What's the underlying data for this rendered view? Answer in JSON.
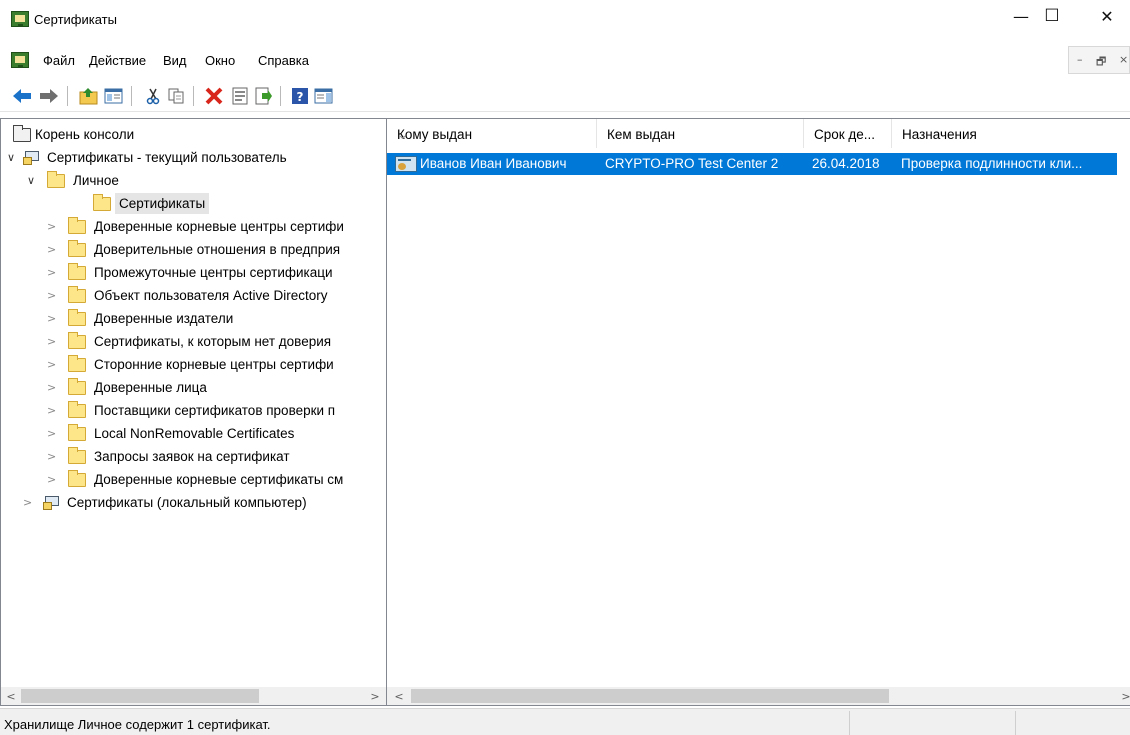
{
  "window": {
    "title": "Сертификаты",
    "minimize_glyph": "—",
    "maximize_glyph": "☐",
    "close_glyph": "✕"
  },
  "menu": {
    "items": [
      "Файл",
      "Действие",
      "Вид",
      "Окно",
      "Справка"
    ],
    "mdi_minimize": "–",
    "mdi_restore": "🗗",
    "mdi_close": "×"
  },
  "toolbar": {
    "icons": [
      "back-icon",
      "forward-icon",
      "up-folder-icon",
      "show-hide-tree-icon",
      "cut-icon",
      "copy-icon",
      "delete-icon",
      "properties-icon",
      "export-list-icon",
      "help-icon",
      "action-pane-icon"
    ]
  },
  "tree": {
    "root": "Корень консоли",
    "current_user": "Сертификаты - текущий пользователь",
    "personal": "Личное",
    "personal_certs": "Сертификаты",
    "stores": [
      "Доверенные корневые центры сертифи",
      "Доверительные отношения в предприя",
      "Промежуточные центры сертификаци",
      "Объект пользователя Active Directory",
      "Доверенные издатели",
      "Сертификаты, к которым нет доверия",
      "Сторонние корневые центры сертифи",
      "Доверенные лица",
      "Поставщики сертификатов проверки п",
      "Local NonRemovable Certificates",
      "Запросы заявок на сертификат",
      "Доверенные корневые сертификаты см"
    ],
    "local_computer": "Сертификаты (локальный компьютер)"
  },
  "list": {
    "columns": [
      "Кому выдан",
      "Кем выдан",
      "Срок де...",
      "Назначения"
    ],
    "sort_glyph": "⌄",
    "rows": [
      {
        "issued_to": "Иванов Иван Иванович",
        "issued_by": "CRYPTO-PRO Test Center 2",
        "expires": "26.04.2018",
        "purposes": "Проверка подлинности кли..."
      }
    ]
  },
  "scroll": {
    "left_arrow": "<",
    "right_arrow": ">"
  },
  "status": {
    "text": "Хранилище Личное содержит 1 сертификат."
  },
  "colors": {
    "selection": "#0078d7",
    "tree_selection": "#e5e5e5"
  }
}
